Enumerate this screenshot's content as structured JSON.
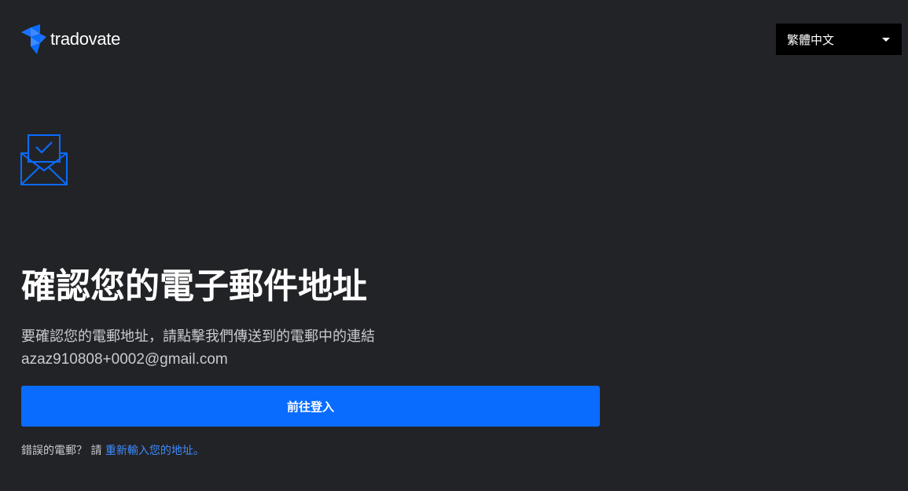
{
  "header": {
    "brand_name": "tradovate",
    "language": {
      "selected": "繁體中文"
    }
  },
  "main": {
    "title": "確認您的電子郵件地址",
    "instruction": "要確認您的電郵地址，請點擊我們傳送到的電郵中的連結",
    "email": "azaz910808+0002@gmail.com",
    "login_button_label": "前往登入",
    "wrong_email_prefix": "錯誤的電郵？ 請 ",
    "reenter_link_label": "重新輸入您的地址。"
  },
  "colors": {
    "background": "#222327",
    "accent": "#0a6cff",
    "link": "#3d8bff",
    "language_select_bg": "#000000"
  },
  "icons": {
    "logo": "tradovate-logo-icon",
    "mail": "mail-check-icon",
    "caret": "caret-down-icon"
  }
}
